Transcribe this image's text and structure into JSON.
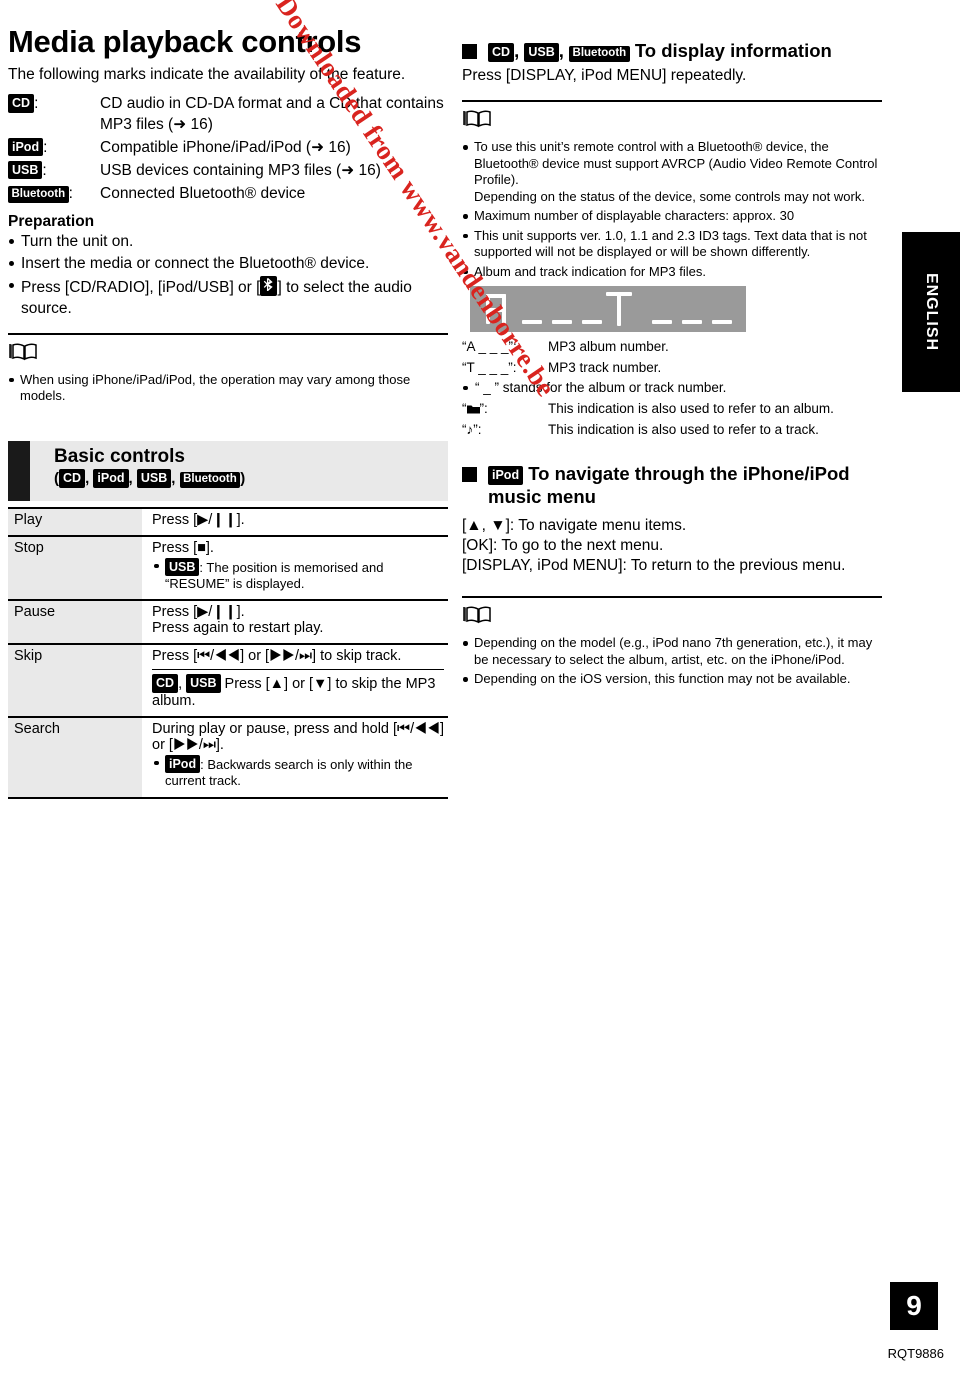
{
  "page": {
    "title": "Media playback controls",
    "intro": "The following marks indicate the availability of the feature.",
    "page_number": "9",
    "doc_code": "RQT9886",
    "language_tab": "ENGLISH",
    "watermark": "Downloaded from www.vandenborre.be",
    "watermark_color": "#d9241f"
  },
  "badges": {
    "cd": "CD",
    "ipod": "iPod",
    "usb": "USB",
    "bluetooth": "Bluetooth"
  },
  "marks": [
    {
      "key": "CD",
      "sep": ":",
      "desc": "CD audio in CD-DA format and a CD that contains MP3 files (➜ 16)"
    },
    {
      "key": "iPod",
      "sep": ":",
      "desc": "Compatible iPhone/iPad/iPod (➜ 16)"
    },
    {
      "key": "USB",
      "sep": ":",
      "desc": "USB devices containing MP3 files (➜ 16)"
    },
    {
      "key": "Bluetooth",
      "sep": ":",
      "desc": "Connected Bluetooth® device"
    }
  ],
  "preparation": {
    "heading": "Preparation",
    "items": [
      "Turn the unit on.",
      "Insert the media or connect the Bluetooth® device.",
      "Press [CD/RADIO], [iPod/USB] or [✶] to select the audio source."
    ],
    "item3_a": "Press [CD/RADIO], [iPod/USB] or [",
    "item3_b": "] to select the audio source."
  },
  "left_note": {
    "items": [
      "When using iPhone/iPad/iPod, the operation may vary among those models."
    ]
  },
  "basic_controls": {
    "title": "Basic controls",
    "open_paren": "(",
    "close_paren": ")",
    "comma": ","
  },
  "table": {
    "rows": [
      {
        "key": "Play",
        "lines": [
          "Press [▶/❙❙]."
        ],
        "notes": [],
        "sub": null
      },
      {
        "key": "Stop",
        "lines": [
          "Press [■]."
        ],
        "notes": [
          {
            "badge": "USB",
            "text": ": The position is memorised and “RESUME” is displayed."
          }
        ],
        "sub": null
      },
      {
        "key": "Pause",
        "lines": [
          "Press [▶/❙❙].",
          "Press again to restart play."
        ],
        "notes": [],
        "sub": null
      },
      {
        "key": "Skip",
        "lines": [
          "Press [⏮/◀◀] or [▶▶/⏭] to skip track."
        ],
        "notes": [],
        "sub": {
          "badge1": "CD",
          "comma": ",",
          "badge2": "USB",
          "text": " Press [▲] or [▼] to skip the MP3 album."
        }
      },
      {
        "key": "Search",
        "lines": [
          "During play or pause, press and hold [⏮/◀◀] or [▶▶/⏭]."
        ],
        "notes": [
          {
            "badge": "iPod",
            "text": ": Backwards search is only within the current track."
          }
        ],
        "sub": null
      }
    ]
  },
  "display_info": {
    "badge1": "CD",
    "badge2": "USB",
    "badge3": "Bluetooth",
    "comma": ",",
    "title": "To display information",
    "instruction": "Press [DISPLAY, iPod MENU] repeatedly.",
    "notes": [
      "To use this unit’s remote control with a Bluetooth® device, the Bluetooth® device must support AVRCP (Audio Video Remote Control Profile).\nDepending on the status of the device, some controls may not work.",
      "Maximum number of displayable characters: approx. 30",
      "This unit supports ver. 1.0, 1.1 and 2.3 ID3 tags. Text data that is not supported will not be displayed or will be shown differently.",
      "Album and track indication for MP3 files."
    ],
    "lcd_text": "A _ _ _    T _ _ _",
    "legend": [
      {
        "key": "“A _ _ _”:",
        "desc": "MP3 album number.",
        "bullet": false
      },
      {
        "key": "“T _ _ _”:",
        "desc": "MP3 track number.",
        "bullet": false
      },
      {
        "key": "“ _ ” stands for the album or track number.",
        "desc": "",
        "bullet": true
      },
      {
        "key": "“▬”:",
        "desc": "This indication is also used to refer to an album.",
        "bullet": false
      },
      {
        "key": "“♪”:",
        "desc": "This indication is also used to refer to a track.",
        "bullet": false
      }
    ]
  },
  "ipod_nav": {
    "badge": "iPod",
    "title": "To navigate through the iPhone/iPod music menu",
    "lines": [
      "[▲, ▼]: To navigate menu items.",
      "[OK]: To go to the next menu.",
      "[DISPLAY, iPod MENU]: To return to the previous menu."
    ],
    "notes": [
      "Depending on the model (e.g., iPod nano 7th generation, etc.), it may be necessary to select the album, artist, etc. on the iPhone/iPod.",
      "Depending on the iOS version, this function may not be available."
    ]
  }
}
